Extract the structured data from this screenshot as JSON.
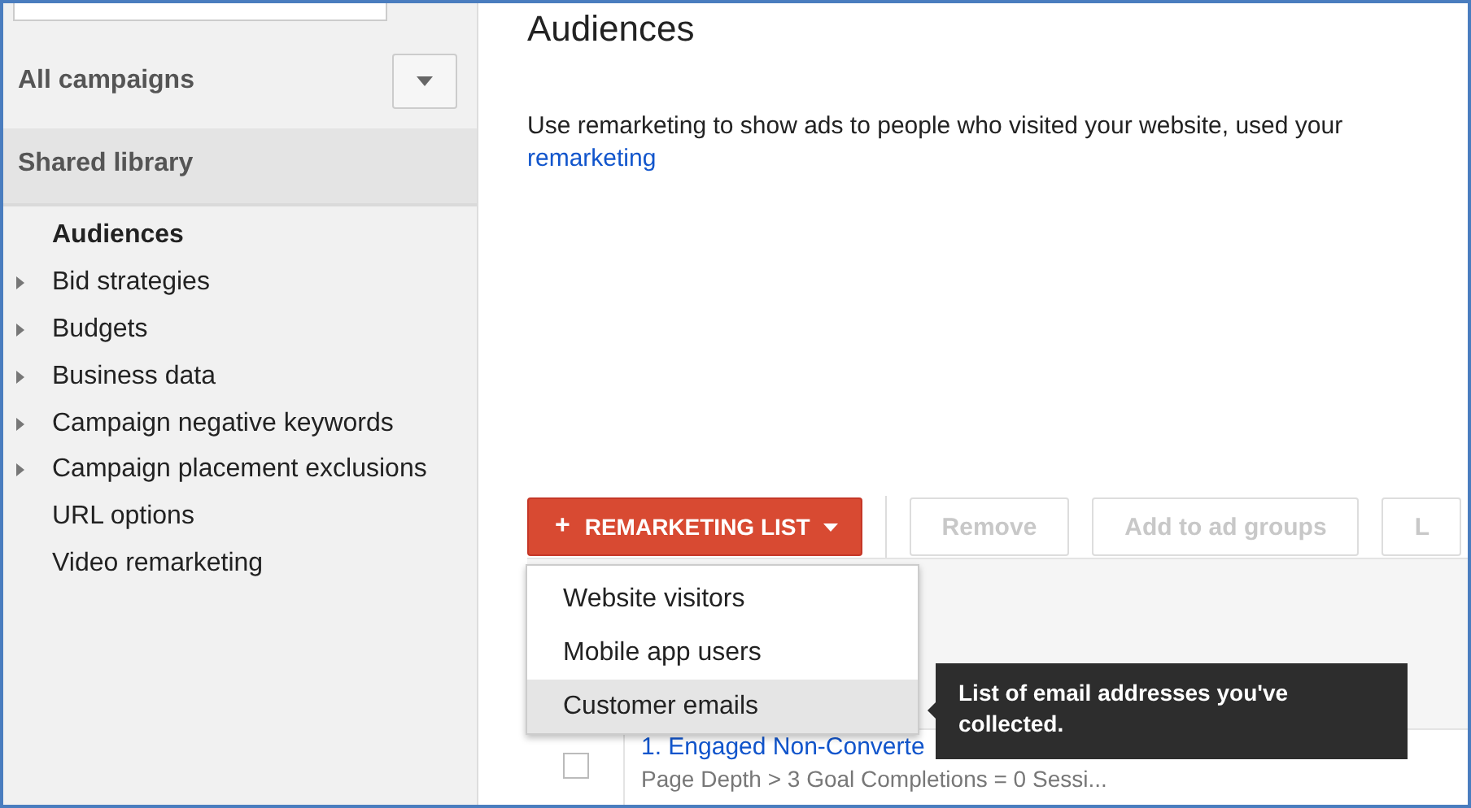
{
  "sidebar": {
    "campaigns": {
      "label": "All campaigns"
    },
    "shared_library": {
      "label": "Shared library"
    },
    "items": [
      {
        "label": "Audiences",
        "selected": true,
        "expandable": false
      },
      {
        "label": "Bid strategies",
        "selected": false,
        "expandable": true
      },
      {
        "label": "Budgets",
        "selected": false,
        "expandable": true
      },
      {
        "label": "Business data",
        "selected": false,
        "expandable": true
      },
      {
        "label": "Campaign negative keywords",
        "selected": false,
        "expandable": true
      },
      {
        "label": "Campaign placement exclusions",
        "selected": false,
        "expandable": true
      },
      {
        "label": "URL options",
        "selected": false,
        "expandable": false
      },
      {
        "label": "Video remarketing",
        "selected": false,
        "expandable": false
      }
    ]
  },
  "main": {
    "title": "Audiences",
    "description": "Use remarketing to show ads to people who visited your website, used your",
    "link": "remarketing"
  },
  "toolbar": {
    "primary": {
      "icon": "+",
      "label": "REMARKETING LIST"
    },
    "buttons": [
      {
        "label": "Remove",
        "disabled": true
      },
      {
        "label": "Add to ad groups",
        "disabled": true
      },
      {
        "label": "L",
        "disabled": true
      }
    ]
  },
  "menu": [
    {
      "label": "Website visitors",
      "selected": false
    },
    {
      "label": "Mobile app users",
      "selected": false
    },
    {
      "label": "Customer emails",
      "selected": true
    }
  ],
  "tooltip": "List of email addresses you've collected.",
  "table": {
    "rows": [
      {
        "checked": false,
        "name": "1. Engaged Non-Converte",
        "detail": "Page Depth > 3 Goal Completions = 0 Sessi..."
      }
    ]
  }
}
